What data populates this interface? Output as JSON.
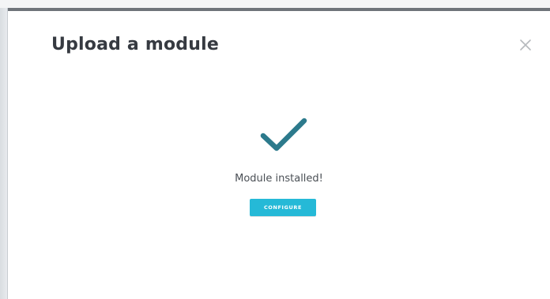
{
  "modal": {
    "title": "Upload a module",
    "close_glyph": "×",
    "close_icon": "close-icon",
    "success_icon": "checkmark-icon",
    "status_message": "Module installed!",
    "configure_label": "CONFIGURE"
  },
  "colors": {
    "accent": "#25b9d7",
    "checkmark": "#2c7a8c",
    "title_text": "#363a41",
    "modal_top_border": "#6f747a"
  }
}
